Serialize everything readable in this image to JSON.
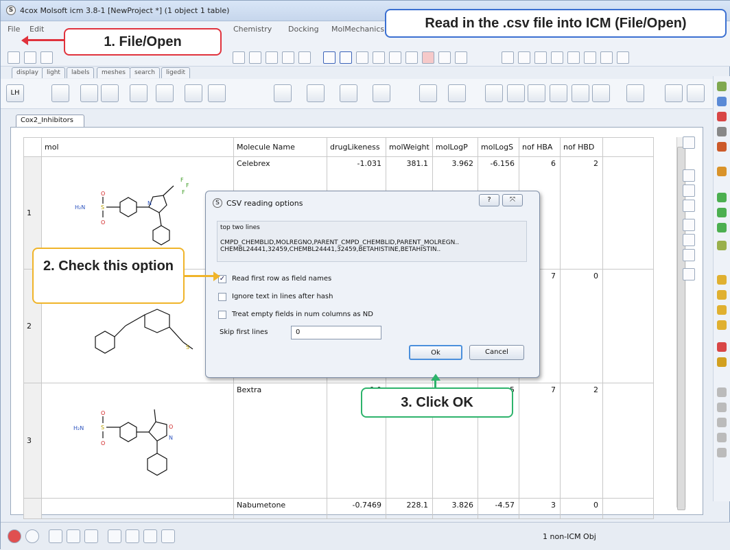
{
  "window_title": "4cox Molsoft icm 3.8-1  [NewProject *] (1 object 1 table)",
  "menu": [
    "File",
    "Edit",
    "Chemistry",
    "Docking",
    "MolMechanics"
  ],
  "view_tabs": [
    "display",
    "light",
    "labels",
    "meshes",
    "search",
    "ligedit"
  ],
  "doc_tab": "Cox2_Inhibitors",
  "table": {
    "columns": [
      "mol",
      "Molecule Name",
      "drugLikeness",
      "molWeight",
      "molLogP",
      "molLogS",
      "nof HBA",
      "nof HBD"
    ],
    "rows": [
      {
        "index": "1",
        "name": "Celebrex",
        "drugLikeness": "-1.031",
        "molWeight": "381.1",
        "molLogP": "3.962",
        "molLogS": "-6.156",
        "hba": "6",
        "hbd": "2"
      },
      {
        "index": "2",
        "name": "",
        "drugLikeness": "",
        "molWeight": "",
        "molLogP": "",
        "molLogS": "",
        "hba": "7",
        "hbd": "0"
      },
      {
        "index": "3",
        "name": "Bextra",
        "drugLikeness": "0.0",
        "molWeight": "",
        "molLogP": "",
        "molLogS": "5",
        "hba": "7",
        "hbd": "2"
      },
      {
        "index": "",
        "name": "Nabumetone",
        "drugLikeness": "-0.7469",
        "molWeight": "228.1",
        "molLogP": "3.826",
        "molLogS": "-4.57",
        "hba": "3",
        "hbd": "0"
      }
    ]
  },
  "dialog": {
    "title": "CSV reading options",
    "group_title": "top two lines",
    "line1": "CMPD_CHEMBLID,MOLREGNO,PARENT_CMPD_CHEMBLID,PARENT_MOLREGN..",
    "line2": "CHEMBL24441,32459,CHEMBL24441,32459,BETAHISTINE,BETAHISTIN..",
    "opt1": "Read first row as field names",
    "opt2": "Ignore text in lines after hash",
    "opt3": "Treat empty fields in num columns as ND",
    "skip_label": "Skip first lines",
    "skip_value": "0",
    "ok": "Ok",
    "cancel": "Cancel",
    "help": "?",
    "close": "⤧"
  },
  "callouts": {
    "c1": "1. File/Open",
    "c2": "2. Check this option",
    "c3": "3. Click OK",
    "banner": "Read in the .csv file into ICM (File/Open)"
  },
  "chem": {
    "h2n": "H₂N",
    "s": "S",
    "o": "O",
    "n": "N",
    "f": "F"
  },
  "status_text": "1 non-ICM Obj",
  "colors": {
    "red": "#e0323c",
    "gold": "#f0b429",
    "green": "#2db36b",
    "blue": "#3a6fd1"
  }
}
